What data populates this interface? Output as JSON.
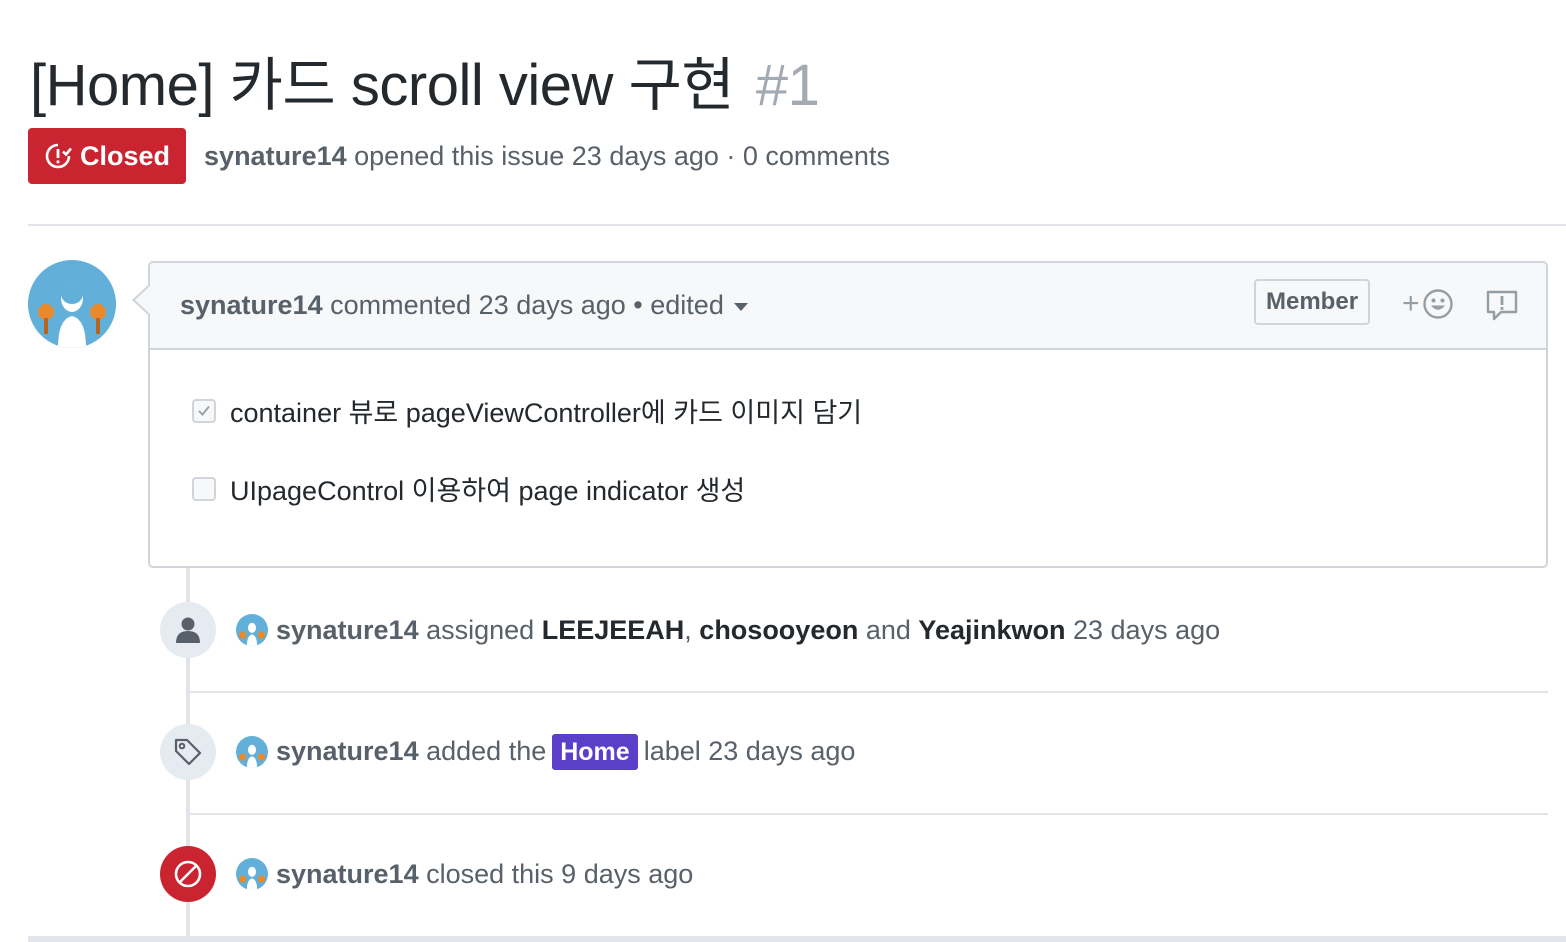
{
  "issue": {
    "title": "[Home] 카드 scroll view 구현",
    "number": "#1",
    "state": "Closed",
    "author": "synature14",
    "opened_text": "opened this issue 23 days ago · 0 comments"
  },
  "comment": {
    "author": "synature14",
    "meta": "commented 23 days ago •",
    "edited": "edited",
    "role": "Member",
    "react_plus": "+",
    "tasks": [
      {
        "label": "container 뷰로 pageViewController에 카드 이미지 담기",
        "checked": true
      },
      {
        "label": "UIpageControl 이용하여 page indicator 생성",
        "checked": false
      }
    ]
  },
  "events": [
    {
      "actor": "synature14",
      "verb": "assigned",
      "assignee1": "LEEJEEAH",
      "comma": ",",
      "assignee2": "chosooyeon",
      "and": "and",
      "assignee3": "Yeajinkwon",
      "time": "23 days ago"
    },
    {
      "actor": "synature14",
      "before": "added the",
      "label": "Home",
      "after": "label 23 days ago",
      "label_color": "#5a40c8"
    },
    {
      "actor": "synature14",
      "text": "closed this 9 days ago"
    }
  ],
  "colors": {
    "closed_red": "#cb2431",
    "muted": "#586069",
    "border": "#d1d5da",
    "avatar_bg": "#62b0d9"
  }
}
